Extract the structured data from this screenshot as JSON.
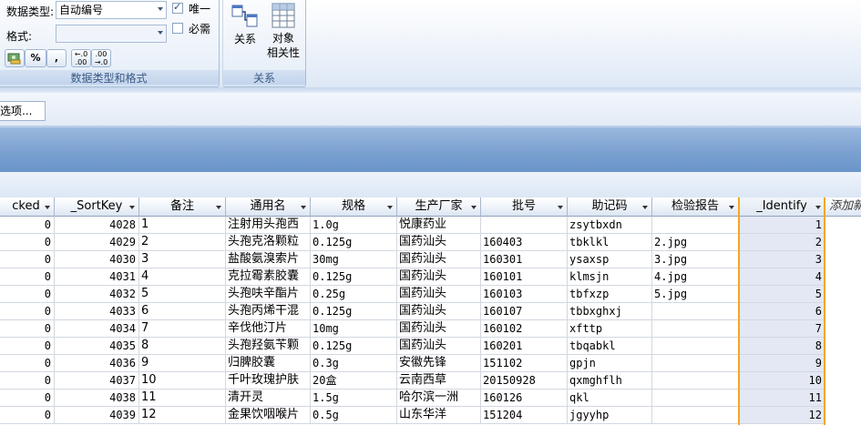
{
  "ribbon": {
    "datatype_group": {
      "datatype_label": "数据类型:",
      "datatype_value": "自动编号",
      "format_label": "格式:",
      "format_value": "",
      "unique_label": "唯一",
      "unique_checked": true,
      "required_label": "必需",
      "required_checked": false,
      "percent_label": "%",
      "comma_label": ",",
      "inc_decimal_label": "+.0 .00",
      "dec_decimal_label": ".00 →.0",
      "group_title": "数据类型和格式"
    },
    "relations_group": {
      "relations_label": "关系",
      "object_dep_label_1": "对象",
      "object_dep_label_2": "相关性",
      "group_title": "关系"
    }
  },
  "optionbar": {
    "options_label": "选项..."
  },
  "grid": {
    "columns": [
      {
        "label": "cked",
        "dropdown": true
      },
      {
        "label": "_SortKey",
        "dropdown": true
      },
      {
        "label": "备注",
        "dropdown": true
      },
      {
        "label": "通用名",
        "dropdown": true
      },
      {
        "label": "规格",
        "dropdown": true
      },
      {
        "label": "生产厂家",
        "dropdown": true
      },
      {
        "label": "批号",
        "dropdown": true
      },
      {
        "label": "助记码",
        "dropdown": true
      },
      {
        "label": "检验报告",
        "dropdown": true
      },
      {
        "label": "_Identify",
        "dropdown": true
      },
      {
        "label": "添加新",
        "dropdown": false
      }
    ],
    "rows": [
      [
        "0",
        "4028",
        "1",
        "注射用头孢西",
        "1.0g",
        "悦康药业",
        "",
        "zsytbxdn",
        "",
        "1"
      ],
      [
        "0",
        "4029",
        "2",
        "头孢克洛颗粒",
        "0.125g",
        "国药汕头",
        "160403",
        "tbklkl",
        "2.jpg",
        "2"
      ],
      [
        "0",
        "4030",
        "3",
        "盐酸氨溴索片",
        "30mg",
        "国药汕头",
        "160301",
        "ysaxsp",
        "3.jpg",
        "3"
      ],
      [
        "0",
        "4031",
        "4",
        "克拉霉素胶囊",
        "0.125g",
        "国药汕头",
        "160101",
        "klmsjn",
        "4.jpg",
        "4"
      ],
      [
        "0",
        "4032",
        "5",
        "头孢呋辛酯片",
        "0.25g",
        "国药汕头",
        "160103",
        "tbfxzp",
        "5.jpg",
        "5"
      ],
      [
        "0",
        "4033",
        "6",
        "头孢丙烯干混",
        "0.125g",
        "国药汕头",
        "160107",
        "tbbxghxj",
        "",
        "6"
      ],
      [
        "0",
        "4034",
        "7",
        "辛伐他汀片",
        "10mg",
        "国药汕头",
        "160102",
        "xfttp",
        "",
        "7"
      ],
      [
        "0",
        "4035",
        "8",
        "头孢羟氨苄颗",
        "0.125g",
        "国药汕头",
        "160201",
        "tbqabkl",
        "",
        "8"
      ],
      [
        "0",
        "4036",
        "9",
        "归脾胶囊",
        "0.3g",
        "安徽先锋",
        "151102",
        "gpjn",
        "",
        "9"
      ],
      [
        "0",
        "4037",
        "10",
        "千叶玫瑰护肤",
        "20盒",
        "云南西草",
        "20150928",
        "qxmghflh",
        "",
        "10"
      ],
      [
        "0",
        "4038",
        "11",
        "清开灵",
        "1.5g",
        "哈尔滨一洲",
        "160126",
        "qkl",
        "",
        "11"
      ],
      [
        "0",
        "4039",
        "12",
        "金果饮咽喉片",
        "0.5g",
        "山东华洋",
        "151204",
        "jgyyhp",
        "",
        "12"
      ]
    ]
  }
}
